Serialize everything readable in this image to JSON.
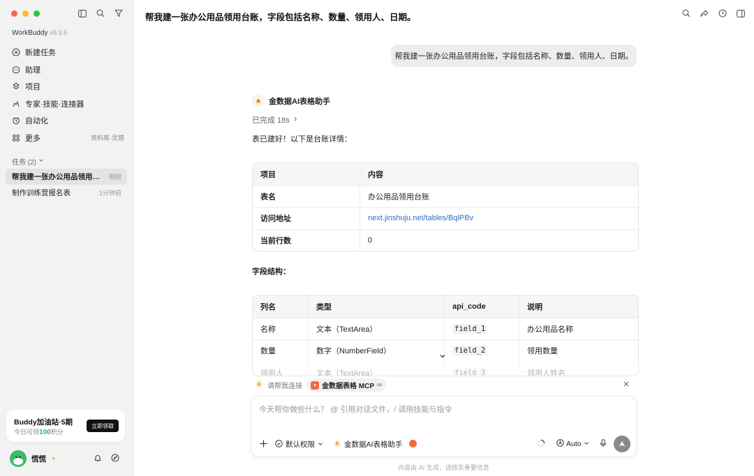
{
  "sidebar": {
    "brand": "WorkBuddy",
    "version": "v5.3.5",
    "nav": [
      {
        "label": "新建任务",
        "icon": "new-task-icon"
      },
      {
        "label": "助理",
        "icon": "assistant-icon"
      },
      {
        "label": "项目",
        "icon": "project-icon"
      },
      {
        "label": "专家·技能·连接器",
        "icon": "expert-icon"
      },
      {
        "label": "自动化",
        "icon": "automation-icon"
      },
      {
        "label": "更多",
        "icon": "more-icon",
        "extra": "资料库·灵感"
      }
    ],
    "tasks_header": "任务 (2)",
    "tasks": [
      {
        "label": "帮我建一张办公用品领用台账，字段包括名称、数量、领用人、日期。",
        "time": "刚刚"
      },
      {
        "label": "制作训练营报名表",
        "time": "1分钟前"
      }
    ],
    "promo": {
      "title": "Buddy加油站·5期",
      "sub_prefix": "今日可领",
      "points": "100",
      "sub_suffix": "积分",
      "button": "立即领取"
    },
    "user": {
      "name": "慌慌"
    }
  },
  "main": {
    "title": "帮我建一张办公用品领用台账，字段包括名称、数量、领用人、日期。",
    "user_message": "帮我建一张办公用品领用台账，字段包括名称、数量、领用人、日期。",
    "assistant": {
      "name": "金数据AI表格助手",
      "status": "已完成 18s",
      "intro": "表已建好！以下是台账详情："
    },
    "table1": {
      "headers": [
        "项目",
        "内容"
      ],
      "rows": [
        [
          "表名",
          "办公用品领用台账"
        ],
        [
          "访问地址",
          "next.jinshuju.net/tables/BqlPBv"
        ],
        [
          "当前行数",
          "0"
        ]
      ]
    },
    "section_title": "字段结构：",
    "table2": {
      "headers": [
        "列名",
        "类型",
        "api_code",
        "说明"
      ],
      "rows": [
        [
          "名称",
          "文本（TextArea）",
          "field_1",
          "办公用品名称"
        ],
        [
          "数量",
          "数字（NumberField）",
          "field_2",
          "领用数量"
        ],
        [
          "领用人",
          "文本（TextArea）",
          "field_3",
          "领用人姓名"
        ]
      ]
    }
  },
  "composer": {
    "connect_prompt": "请帮我连接",
    "mcp_label": "金数据表格 MCP",
    "mcp_suffix": "∞",
    "placeholder": "今天帮你做些什么？ @ 引用对话文件，/ 调用技能与指令",
    "permission": "默认权限",
    "agent": "金数据AI表格助手",
    "model": "Auto"
  },
  "footer_note": "内容由 AI 生成，请核实重要信息",
  "colors": {
    "accent_orange": "#ef6b3a",
    "link": "#2f6bc9",
    "points_green": "#2bb56a"
  }
}
